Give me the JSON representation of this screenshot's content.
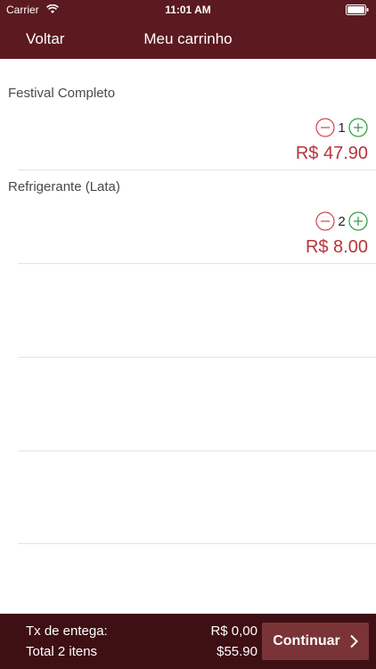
{
  "status_bar": {
    "carrier": "Carrier",
    "time": "11:01 AM"
  },
  "nav": {
    "back_label": "Voltar",
    "title": "Meu carrinho"
  },
  "cart": {
    "items": [
      {
        "name": "Festival Completo",
        "quantity": "1",
        "price": "R$ 47.90"
      },
      {
        "name": "Refrigerante (Lata)",
        "quantity": "2",
        "price": "R$ 8.00"
      }
    ]
  },
  "footer": {
    "fee_label": "Tx de entega:",
    "fee_value": "R$ 0,00",
    "total_label": "Total  2 itens",
    "total_value": "$55.90",
    "continue_label": "Continuar"
  },
  "colors": {
    "nav_background": "#5b1a1f",
    "footer_background": "#3e0f13",
    "price": "#b8343b",
    "minus": "#d0454c",
    "plus": "#2e9a3a",
    "continue_button": "#7a3438"
  },
  "icons": {
    "wifi": "wifi-icon",
    "battery": "battery-icon",
    "minus": "minus-circle-icon",
    "plus": "plus-circle-icon",
    "chevron": "chevron-right-icon"
  }
}
